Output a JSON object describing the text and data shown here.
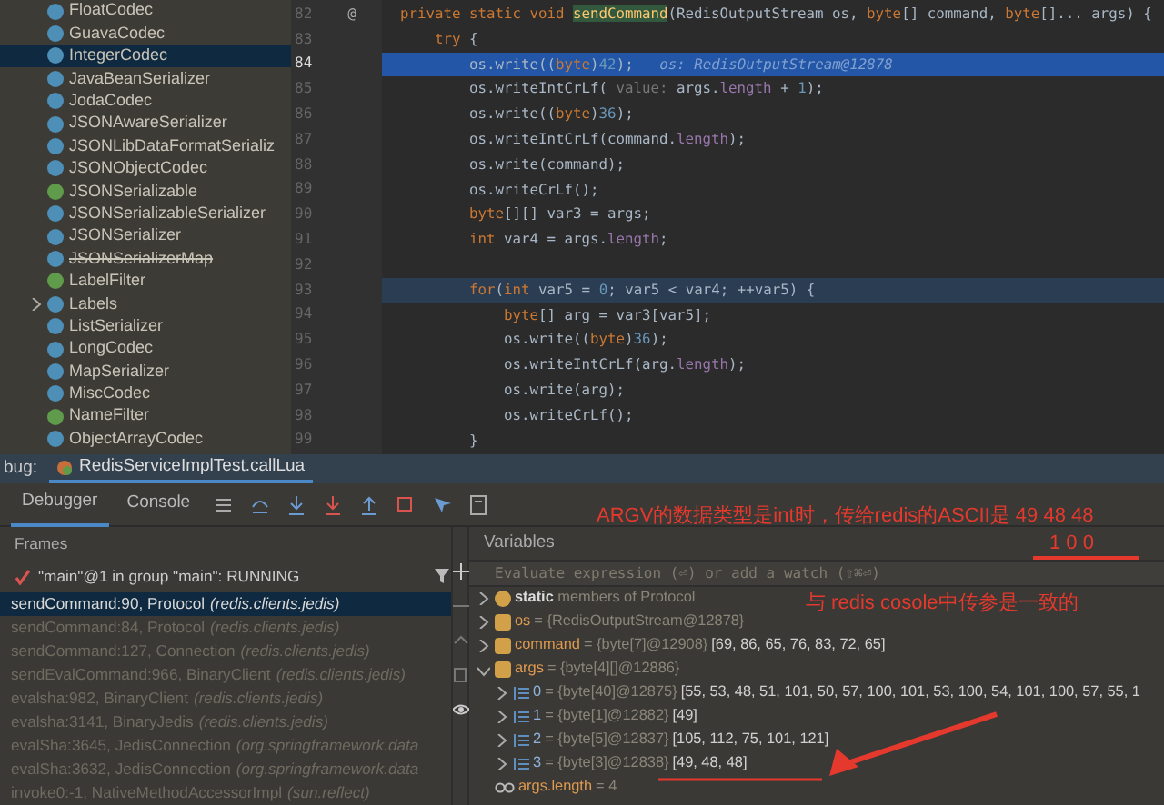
{
  "project_tree": {
    "items": [
      {
        "label": "FloatCodec",
        "kind": "class",
        "selected": false
      },
      {
        "label": "GuavaCodec",
        "kind": "class",
        "selected": false
      },
      {
        "label": "IntegerCodec",
        "kind": "class",
        "selected": true
      },
      {
        "label": "JavaBeanSerializer",
        "kind": "class",
        "selected": false
      },
      {
        "label": "JodaCodec",
        "kind": "class",
        "selected": false
      },
      {
        "label": "JSONAwareSerializer",
        "kind": "class",
        "selected": false
      },
      {
        "label": "JSONLibDataFormatSerializ",
        "kind": "class",
        "selected": false
      },
      {
        "label": "JSONObjectCodec",
        "kind": "class",
        "selected": false
      },
      {
        "label": "JSONSerializable",
        "kind": "interface",
        "selected": false
      },
      {
        "label": "JSONSerializableSerializer",
        "kind": "class",
        "selected": false
      },
      {
        "label": "JSONSerializer",
        "kind": "class",
        "selected": false
      },
      {
        "label": "JSONSerializerMap",
        "kind": "class",
        "selected": false,
        "deprecated": true
      },
      {
        "label": "LabelFilter",
        "kind": "interface",
        "selected": false
      },
      {
        "label": "Labels",
        "kind": "class",
        "selected": false,
        "expanded": false
      },
      {
        "label": "ListSerializer",
        "kind": "class",
        "selected": false
      },
      {
        "label": "LongCodec",
        "kind": "class",
        "selected": false
      },
      {
        "label": "MapSerializer",
        "kind": "class",
        "selected": false
      },
      {
        "label": "MiscCodec",
        "kind": "class",
        "selected": false
      },
      {
        "label": "NameFilter",
        "kind": "interface",
        "selected": false
      },
      {
        "label": "ObjectArrayCodec",
        "kind": "class",
        "selected": false
      }
    ]
  },
  "editor": {
    "lines": [
      {
        "number": "82",
        "current": false,
        "highlighted": false,
        "gutter_mark": "@",
        "tokens": [
          {
            "kind": "keyword",
            "text": "private static void "
          },
          {
            "kind": "match",
            "text": "sendCommand"
          },
          {
            "kind": "plain",
            "text": "(RedisOutputStream os, "
          },
          {
            "kind": "keyword",
            "text": "byte"
          },
          {
            "kind": "plain",
            "text": "[] command, "
          },
          {
            "kind": "keyword",
            "text": "byte"
          },
          {
            "kind": "plain",
            "text": "[]... args) {"
          }
        ]
      },
      {
        "number": "83",
        "current": false,
        "highlighted": false,
        "tokens": [
          {
            "kind": "keyword",
            "text": "    try "
          },
          {
            "kind": "plain",
            "text": "{"
          }
        ]
      },
      {
        "number": "84",
        "current": true,
        "highlighted": false,
        "tokens": [
          {
            "kind": "plain",
            "text": "        os.write(("
          },
          {
            "kind": "keyword",
            "text": "byte"
          },
          {
            "kind": "plain",
            "text": ")"
          },
          {
            "kind": "number",
            "text": "42"
          },
          {
            "kind": "plain",
            "text": ");"
          },
          {
            "kind": "inline",
            "text": "   os: RedisOutputStream@12878"
          }
        ]
      },
      {
        "number": "85",
        "current": false,
        "highlighted": false,
        "tokens": [
          {
            "kind": "plain",
            "text": "        os.writeIntCrLf( "
          },
          {
            "kind": "hint",
            "text": "value:"
          },
          {
            "kind": "plain",
            "text": " args."
          },
          {
            "kind": "field",
            "text": "length"
          },
          {
            "kind": "plain",
            "text": " + "
          },
          {
            "kind": "number",
            "text": "1"
          },
          {
            "kind": "plain",
            "text": ");"
          }
        ]
      },
      {
        "number": "86",
        "current": false,
        "highlighted": false,
        "tokens": [
          {
            "kind": "plain",
            "text": "        os.write(("
          },
          {
            "kind": "keyword",
            "text": "byte"
          },
          {
            "kind": "plain",
            "text": ")"
          },
          {
            "kind": "number",
            "text": "36"
          },
          {
            "kind": "plain",
            "text": ");"
          }
        ]
      },
      {
        "number": "87",
        "current": false,
        "highlighted": false,
        "tokens": [
          {
            "kind": "plain",
            "text": "        os.writeIntCrLf(command."
          },
          {
            "kind": "field",
            "text": "length"
          },
          {
            "kind": "plain",
            "text": ");"
          }
        ]
      },
      {
        "number": "88",
        "current": false,
        "highlighted": false,
        "tokens": [
          {
            "kind": "plain",
            "text": "        os.write(command);"
          }
        ]
      },
      {
        "number": "89",
        "current": false,
        "highlighted": false,
        "tokens": [
          {
            "kind": "plain",
            "text": "        os.writeCrLf();"
          }
        ]
      },
      {
        "number": "90",
        "current": false,
        "highlighted": false,
        "tokens": [
          {
            "kind": "keyword",
            "text": "        byte"
          },
          {
            "kind": "plain",
            "text": "[][] var3 = args;"
          }
        ]
      },
      {
        "number": "91",
        "current": false,
        "highlighted": false,
        "tokens": [
          {
            "kind": "keyword",
            "text": "        int "
          },
          {
            "kind": "plain",
            "text": "var4 = args."
          },
          {
            "kind": "field",
            "text": "length"
          },
          {
            "kind": "plain",
            "text": ";"
          }
        ]
      },
      {
        "number": "92",
        "current": false,
        "highlighted": false
      },
      {
        "number": "93",
        "current": false,
        "highlighted": true,
        "tokens": [
          {
            "kind": "keyword",
            "text": "        for"
          },
          {
            "kind": "plain",
            "text": "("
          },
          {
            "kind": "keyword",
            "text": "int "
          },
          {
            "kind": "plain",
            "text": "var5 = "
          },
          {
            "kind": "number",
            "text": "0"
          },
          {
            "kind": "plain",
            "text": "; var5 < var4; ++var5) {"
          }
        ]
      },
      {
        "number": "94",
        "current": false,
        "highlighted": false,
        "tokens": [
          {
            "kind": "keyword",
            "text": "            byte"
          },
          {
            "kind": "plain",
            "text": "[] arg = var3[var5];"
          }
        ]
      },
      {
        "number": "95",
        "current": false,
        "highlighted": false,
        "tokens": [
          {
            "kind": "plain",
            "text": "            os.write(("
          },
          {
            "kind": "keyword",
            "text": "byte"
          },
          {
            "kind": "plain",
            "text": ")"
          },
          {
            "kind": "number",
            "text": "36"
          },
          {
            "kind": "plain",
            "text": ");"
          }
        ]
      },
      {
        "number": "96",
        "current": false,
        "highlighted": false,
        "tokens": [
          {
            "kind": "plain",
            "text": "            os.writeIntCrLf(arg."
          },
          {
            "kind": "field",
            "text": "length"
          },
          {
            "kind": "plain",
            "text": ");"
          }
        ]
      },
      {
        "number": "97",
        "current": false,
        "highlighted": false,
        "tokens": [
          {
            "kind": "plain",
            "text": "            os.write(arg);"
          }
        ]
      },
      {
        "number": "98",
        "current": false,
        "highlighted": false,
        "tokens": [
          {
            "kind": "plain",
            "text": "            os.writeCrLf();"
          }
        ]
      },
      {
        "number": "99",
        "current": false,
        "highlighted": false,
        "tokens": [
          {
            "kind": "plain",
            "text": "        }"
          }
        ]
      }
    ]
  },
  "debug": {
    "label": "bug:",
    "session_tab": "RedisServiceImplTest.callLua",
    "tabs": [
      {
        "label": "Debugger",
        "selected": true
      },
      {
        "label": "Console",
        "selected": false
      }
    ],
    "frames": {
      "title": "Frames",
      "thread": "\"main\"@1 in group \"main\": RUNNING",
      "items": [
        {
          "method": "sendCommand:90, Protocol",
          "package": "(redis.clients.jedis)",
          "selected": true
        },
        {
          "method": "sendCommand:84, Protocol",
          "package": "(redis.clients.jedis)",
          "selected": false
        },
        {
          "method": "sendCommand:127, Connection",
          "package": "(redis.clients.jedis)",
          "selected": false
        },
        {
          "method": "sendEvalCommand:966, BinaryClient",
          "package": "(redis.clients.jedis)",
          "selected": false
        },
        {
          "method": "evalsha:982, BinaryClient",
          "package": "(redis.clients.jedis)",
          "selected": false
        },
        {
          "method": "evalsha:3141, BinaryJedis",
          "package": "(redis.clients.jedis)",
          "selected": false
        },
        {
          "method": "evalSha:3645, JedisConnection",
          "package": "(org.springframework.data",
          "selected": false
        },
        {
          "method": "evalSha:3632, JedisConnection",
          "package": "(org.springframework.data",
          "selected": false
        },
        {
          "method": "invoke0:-1, NativeMethodAccessorImpl",
          "package": "(sun.reflect)",
          "selected": false
        }
      ]
    },
    "variables": {
      "title": "Variables",
      "placeholder": "Evaluate expression (⏎) or add a watch (⇧⌘⏎)",
      "items": [
        {
          "kind": "static",
          "label": "**static** members of Protocol",
          "expanded": false
        },
        {
          "kind": "param",
          "name": "os",
          "type": "= {RedisOutputStream@12878}",
          "expanded": false
        },
        {
          "kind": "param",
          "name": "command",
          "type": "= {byte[7]@12908}",
          "value": "[69, 86, 65, 76, 83, 72, 65]",
          "expanded": false
        },
        {
          "kind": "param",
          "name": "args",
          "type": "= {byte[4][]@12886}",
          "expanded": true,
          "children": [
            {
              "kind": "element",
              "name": "0",
              "type": "= {byte[40]@12875}",
              "value": "[55, 53, 48, 51, 101, 50, 57, 100, 101, 53, 100, 54, 101, 100, 57, 55, 1",
              "expanded": false
            },
            {
              "kind": "element",
              "name": "1",
              "type": "= {byte[1]@12882}",
              "value": "[49]",
              "expanded": false
            },
            {
              "kind": "element",
              "name": "2",
              "type": "= {byte[5]@12837}",
              "value": "[105, 112, 75, 101, 121]",
              "expanded": false
            },
            {
              "kind": "element",
              "name": "3",
              "type": "= {byte[3]@12838}",
              "value": "[49, 48, 48]",
              "expanded": false
            }
          ]
        },
        {
          "kind": "watch",
          "name": "args.length",
          "type": "= 4"
        }
      ]
    }
  },
  "annotations": {
    "note": "ARGV的数据类型是int时，传给redis的ASCII是 49 48 48",
    "digits": "1  0  0",
    "remark": "与 redis cosole中传参是一致的"
  }
}
